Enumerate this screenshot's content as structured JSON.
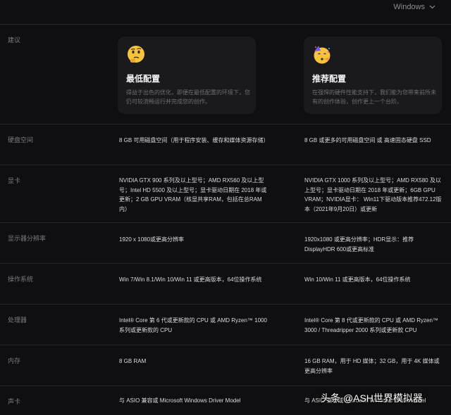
{
  "header": {
    "os_selected": "Windows"
  },
  "suggestion": {
    "label": "建议",
    "min": {
      "title": "最低配置",
      "desc": "得益于出色的优化，即便在最低配置的环境下，您仍可较流畅运行并完成您的创作。",
      "icon": "thinking-face-emoji"
    },
    "rec": {
      "title": "推荐配置",
      "desc": "在强悍的硬件性能支持下，我们能为您带来前所未有的创作体验，创作更上一个台阶。",
      "icon": "party-face-emoji"
    }
  },
  "specs": [
    {
      "label": "硬盘空间",
      "min": "8 GB 可用磁盘空间（用于程序安装、缓存和媒体资源存储）",
      "rec": "8 GB 或更多的可用磁盘空间 或 高速固态硬盘 SSD"
    },
    {
      "label": "显卡",
      "min": "NVIDIA GTX 900 系列及以上型号；AMD RX560 及以上型号；Intel HD 5500 及以上型号；显卡驱动日期在 2018 年或更新；2 GB GPU VRAM（核显共享RAM，包括在总RAM内）",
      "rec": "NVIDIA GTX 1000 系列及以上型号；AMD RX580 及以上型号；显卡驱动日期在 2018 年或更新；6GB GPU VRAM；NVIDIA显卡： Win11下驱动版本推荐472.12版本（2021年9月20日）或更新"
    },
    {
      "label": "显示器分辨率",
      "min": "1920 x 1080或更高分辨率",
      "rec": "1920x1080 或更高分辨率；HDR显示：推荐 DisplayHDR 600或更高标准"
    },
    {
      "label": "操作系统",
      "min": "Win 7/Win 8.1/Win 10/Win 11 或更高版本，64位操作系统",
      "rec": "Win 10/Win 11 或更高版本，64位操作系统"
    },
    {
      "label": "处理器",
      "min": "Intel® Core 第 6 代或更新款的 CPU 或 AMD Ryzen™ 1000 系列或更新款的 CPU",
      "rec": "Intel® Core 第 8 代或更新款的 CPU 或 AMD Ryzen™ 3000 / Threadripper 2000 系列或更新款 CPU"
    },
    {
      "label": "内存",
      "min": "8 GB RAM",
      "rec": "16 GB RAM，用于 HD 媒体；32 GB，用于 4K 媒体或更高分辨率"
    },
    {
      "label": "声卡",
      "min": "与 ASIO 兼容或 Microsoft Windows Driver Model",
      "rec": "与 ASIO 兼容或 Microsoft Windows Driver Model"
    }
  ],
  "watermark": "头条 @ASH世界模拟器"
}
